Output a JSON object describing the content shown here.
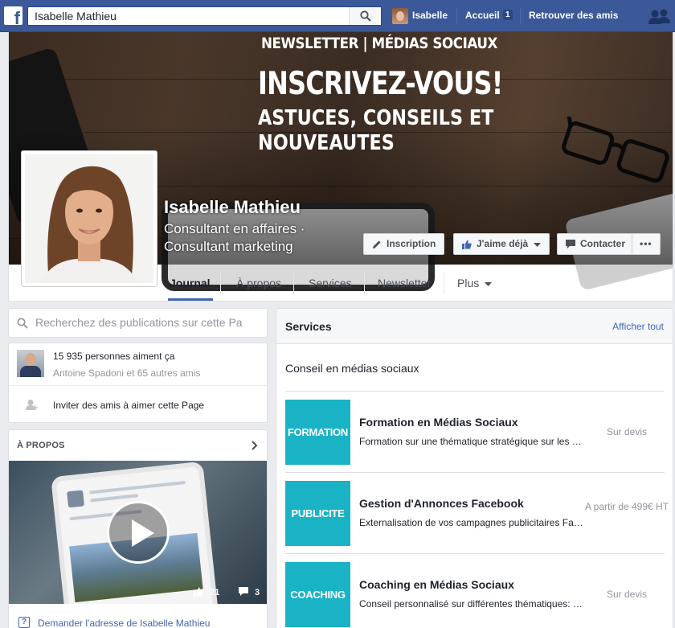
{
  "topbar": {
    "logo": "f",
    "search_value": "Isabelle Mathieu",
    "user_name": "Isabelle",
    "home_label": "Accueil",
    "home_badge": "1",
    "find_friends_label": "Retrouver des amis",
    "icons": [
      "facebook-logo-icon",
      "search-icon",
      "friends-icon"
    ],
    "brand_color": "#3b5998"
  },
  "cover": {
    "newsletter_line": "NEWSLETTER | MÉDIAS SOCIAUX",
    "headline": "INSCRIVEZ-VOUS!",
    "subline": "ASTUCES, CONSEILS ET NOUVEAUTES",
    "page_name": "Isabelle Mathieu",
    "category": "Consultant en affaires · Consultant marketing"
  },
  "actions": {
    "inscription": "Inscription",
    "like": "J'aime déjà",
    "contact": "Contacter",
    "more": "•••"
  },
  "tabs": [
    "Journal",
    "À propos",
    "Services",
    "Newsletter",
    "Plus"
  ],
  "left": {
    "search_placeholder": "Recherchez des publications sur cette Pa",
    "likes_count": "15 935 personnes aiment ça",
    "likes_friends": "Antoine Spadoni et 65 autres amis",
    "invite": "Inviter des amis à aimer cette Page",
    "about_title": "À PROPOS",
    "video_likes": "21",
    "video_comments": "3",
    "ask_address": "Demander l'adresse de Isabelle Mathieu"
  },
  "services": {
    "title": "Services",
    "see_all": "Afficher tout",
    "intro": "Conseil en médias sociaux",
    "accent_color": "#1ab3c6",
    "items": [
      {
        "thumb": "FORMATION",
        "name": "Formation en Médias Sociaux",
        "desc": "Formation sur une thématique stratégique sur les …",
        "price": "Sur devis"
      },
      {
        "thumb": "PUBLICITE",
        "name": "Gestion d'Annonces Facebook",
        "desc": "Externalisation de vos campagnes publicitaires Fa…",
        "price": "A partir de 499€ HT"
      },
      {
        "thumb": "COACHING",
        "name": "Coaching en Médias Sociaux",
        "desc": "Conseil personnalisé sur différentes thématiques: …",
        "price": "Sur devis"
      }
    ]
  }
}
